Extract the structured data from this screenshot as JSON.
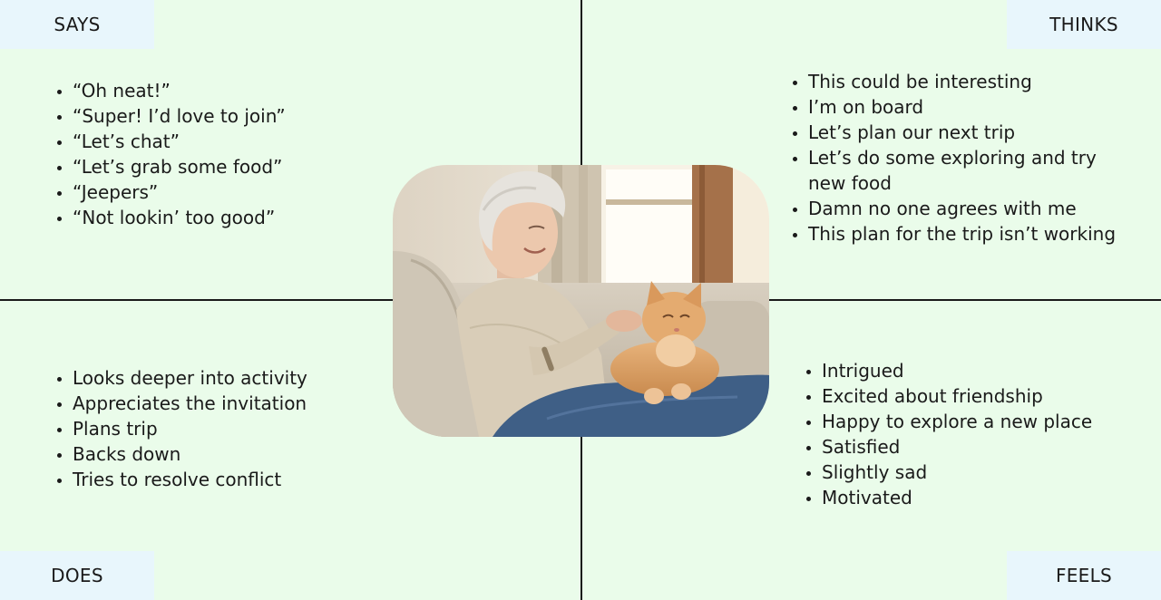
{
  "says": {
    "label": "SAYS",
    "items": [
      "“Oh neat!”",
      "“Super! I’d love to join”",
      "“Let’s chat”",
      "“Let’s grab some food”",
      "“Jeepers”",
      "“Not lookin’ too good”"
    ]
  },
  "thinks": {
    "label": "THINKS",
    "items": [
      "This could be interesting",
      "I’m on board",
      "Let’s plan our next trip",
      "Let’s do some exploring and try new food",
      "Damn no one agrees with me",
      "This plan for the trip isn’t working"
    ]
  },
  "does": {
    "label": "DOES",
    "items": [
      "Looks deeper into activity",
      "Appreciates the invitation",
      "Plans trip",
      "Backs down",
      "Tries to resolve conflict"
    ]
  },
  "feels": {
    "label": "FEELS",
    "items": [
      "Intrigued",
      "Excited about friendship",
      "Happy to explore a new place",
      "Satisfied",
      "Slightly sad",
      "Motivated"
    ]
  },
  "colors": {
    "background": "#eafcea",
    "corner_label_bg": "#e8f6fc",
    "divider": "#1a1a1a"
  }
}
